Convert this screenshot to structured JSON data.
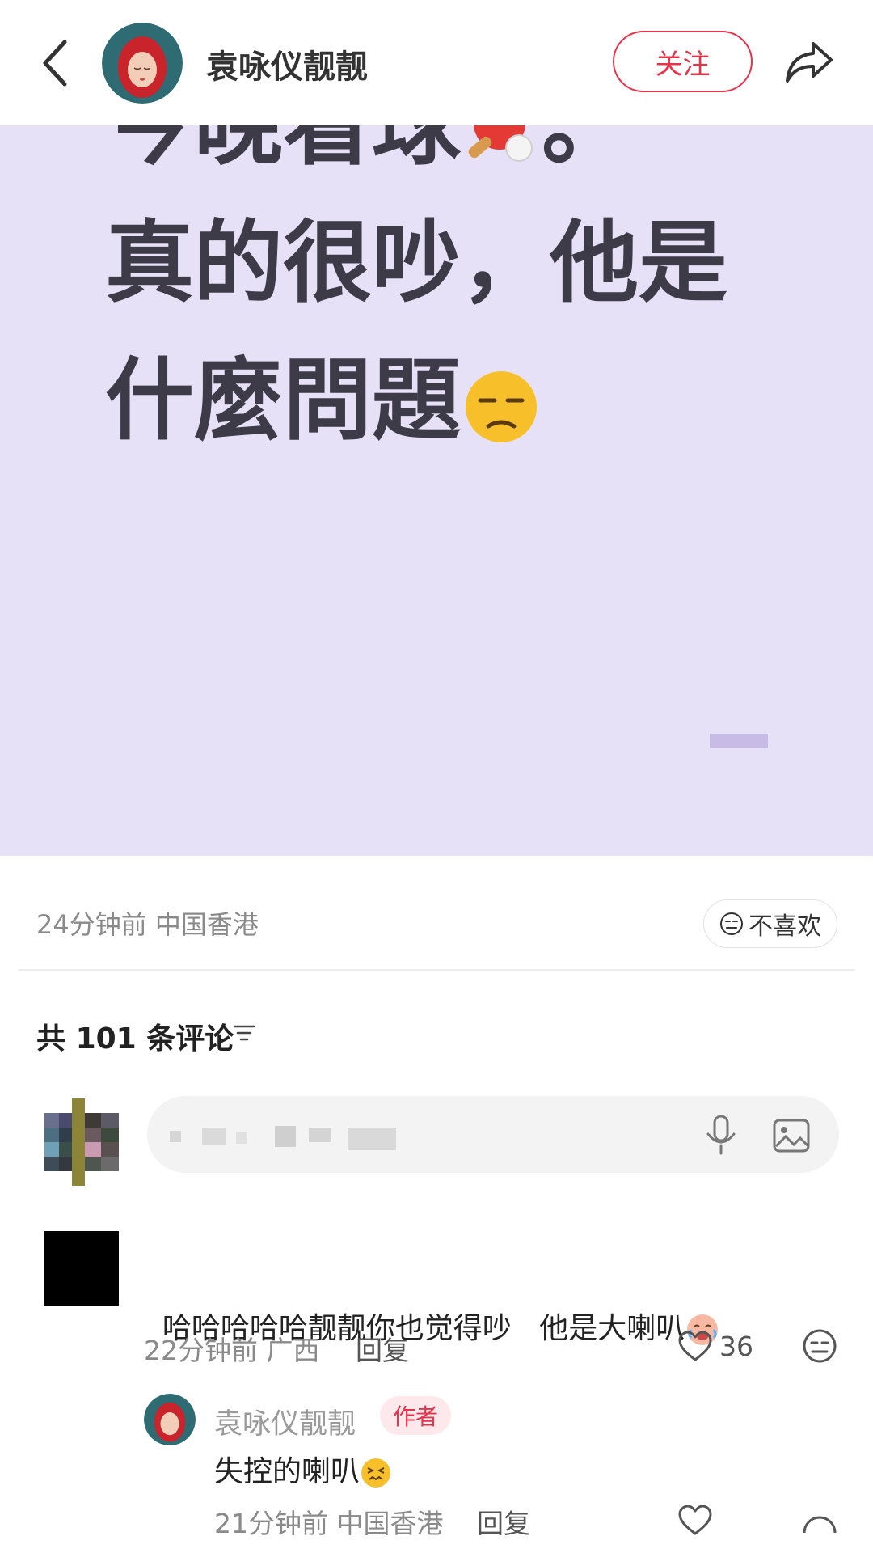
{
  "header": {
    "author_name": "袁咏仪靓靓",
    "follow_label": "关注"
  },
  "post": {
    "lines": [
      "今晚看球",
      "真的很吵，他是",
      "什麼問題"
    ],
    "line1_suffix": "。",
    "time": "24分钟前",
    "location": "中国香港",
    "dislike_label": "不喜欢"
  },
  "comments": {
    "title_prefix": "共",
    "count": "101",
    "title_suffix": "条评论",
    "items": [
      {
        "text": "哈哈哈哈哈靓靓你也觉得吵   他是大喇叭",
        "time": "22分钟前",
        "location": "广西",
        "reply_label": "回复",
        "likes": "36",
        "replies": [
          {
            "name": "袁咏仪靓靓",
            "badge": "作者",
            "text": "失控的喇叭",
            "time": "21分钟前",
            "location": "中国香港",
            "reply_label": "回复"
          }
        ]
      }
    ]
  },
  "colors": {
    "accent": "#e7334a",
    "post_bg": "#e6e1f7",
    "post_text": "#3d3b48"
  }
}
